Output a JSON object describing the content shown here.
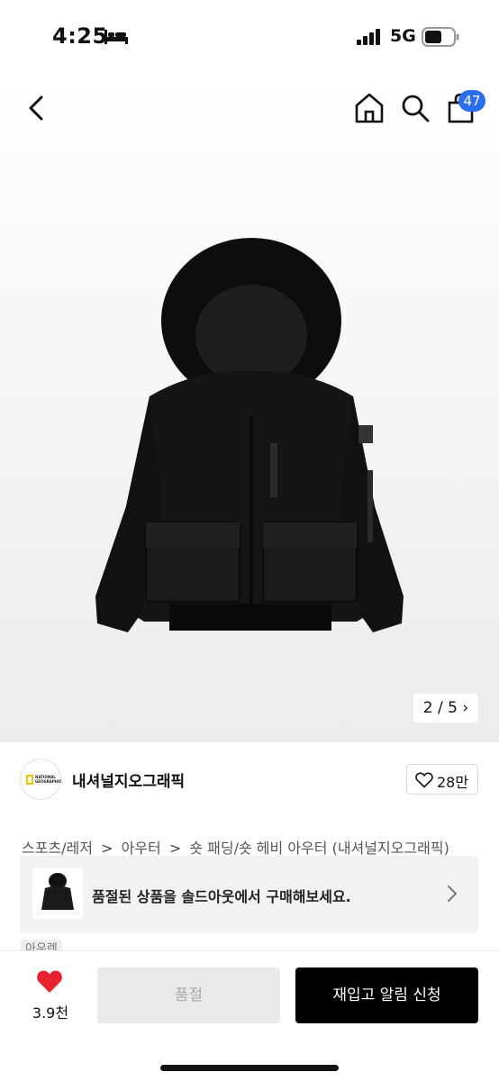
{
  "status_bar": {
    "time": "4:25",
    "network": "5G"
  },
  "header": {
    "cart_count": "47"
  },
  "gallery": {
    "page_indicator": "2 / 5",
    "chevron": "›"
  },
  "brand": {
    "name": "내셔널지오그래픽",
    "logo_text": "NATIONAL GEOGRAPHIC",
    "like_count": "28만"
  },
  "breadcrumb": {
    "items": [
      "스포츠/레저",
      "아우터",
      "숏 패딩/숏 헤비 아우터 (내셔널지오그래픽)"
    ],
    "separator": ">"
  },
  "soldout_banner": {
    "text": "품절된 상품을 솔드아웃에서 구매해보세요."
  },
  "partial_tag": "아우렌",
  "bottom_bar": {
    "wish_count": "3.9천",
    "soldout_label": "품절",
    "restock_label": "재입고 알림 신청"
  },
  "colors": {
    "badge": "#2b6ef2",
    "heart": "#e8222e",
    "primary_button": "#000000"
  }
}
